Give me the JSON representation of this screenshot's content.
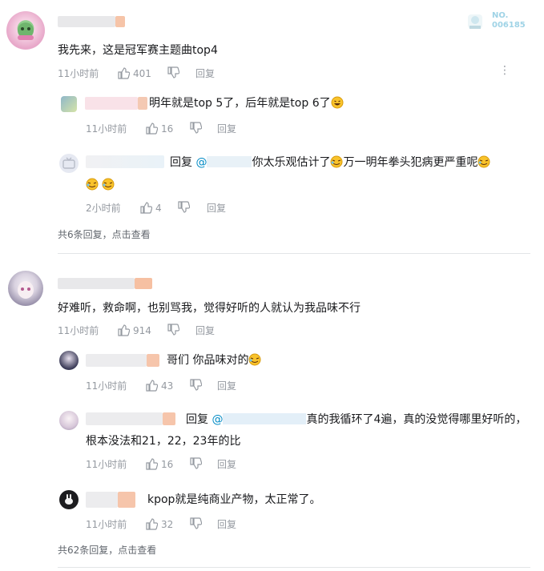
{
  "badge": {
    "label": "NO.",
    "number": "006185"
  },
  "comments": [
    {
      "text": "我先来，这是冠军赛主题曲top4",
      "time": "11小时前",
      "likes": "401",
      "reply_label": "回复",
      "replies": [
        {
          "text": "明年就是top 5了，后年就是top 6了",
          "time": "11小时前",
          "likes": "16",
          "reply_label": "回复"
        },
        {
          "reply_prefix": "回复",
          "mention": "@",
          "text": "你太乐观估计了",
          "text2": "万一明年拳头犯病更严重呢",
          "time": "2小时前",
          "likes": "4",
          "reply_label": "回复"
        }
      ],
      "more": "共6条回复，点击查看"
    },
    {
      "text": "好难听，救命啊，也别骂我，觉得好听的人就认为我品味不行",
      "time": "11小时前",
      "likes": "914",
      "reply_label": "回复",
      "replies": [
        {
          "text": "哥们 你品味对的",
          "time": "11小时前",
          "likes": "43",
          "reply_label": "回复"
        },
        {
          "reply_prefix": "回复",
          "mention": "@",
          "text": "真的我循环了4遍，真的没觉得哪里好听的，",
          "text2": "根本没法和21，22，23年的比",
          "time": "11小时前",
          "likes": "16",
          "reply_label": "回复"
        },
        {
          "text": "kpop就是纯商业产物，太正常了。",
          "time": "11小时前",
          "likes": "32",
          "reply_label": "回复"
        }
      ],
      "more": "共62条回复，点击查看"
    }
  ],
  "colors": {
    "accent": "#008ac5",
    "muted": "#9499a0",
    "divider": "#e3e5e7"
  }
}
